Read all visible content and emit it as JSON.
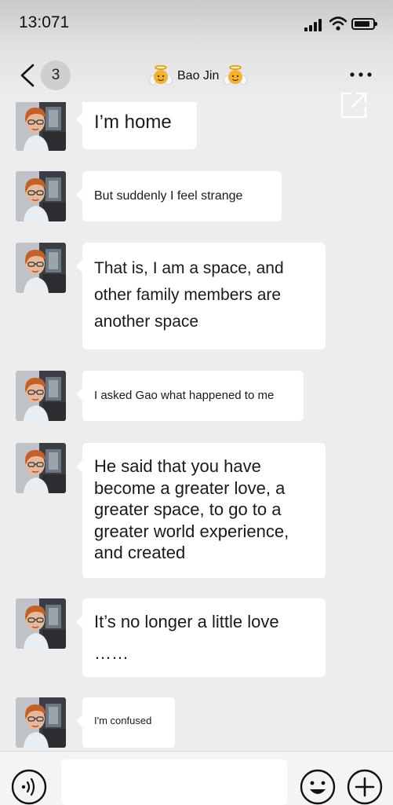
{
  "status_bar": {
    "time": "13:071",
    "icons": [
      "signal-icon",
      "wifi-icon",
      "battery-icon"
    ]
  },
  "nav_bar": {
    "back_icon": "chevron-left-icon",
    "unread_count": "3",
    "title": "Bao Jin",
    "title_icons": [
      "angel-emoji-icon",
      "angel-emoji-icon"
    ],
    "more_icon": "ellipsis-icon",
    "share_icon": "external-share-icon"
  },
  "messages": [
    {
      "text": "I’m home",
      "from": "contact"
    },
    {
      "text": "But suddenly I feel strange",
      "from": "contact"
    },
    {
      "text": "That is, I am a space, and other family members are another space",
      "from": "contact"
    },
    {
      "text": "I asked Gao what happened to me",
      "from": "contact"
    },
    {
      "text": "He said that you have become a greater love, a greater space, to go to a greater world experience, and created",
      "from": "contact"
    },
    {
      "text": "It’s no longer a little love ……",
      "from": "contact"
    },
    {
      "text": "I'm confused",
      "from": "contact"
    }
  ],
  "input_bar": {
    "voice_icon": "voice-input-icon",
    "text_value": "",
    "emoji_icon": "smiley-face-icon",
    "add_icon": "plus-circle-icon"
  },
  "colors": {
    "background": "#ededed",
    "bubble": "#ffffff",
    "text": "#1a1a1a"
  }
}
